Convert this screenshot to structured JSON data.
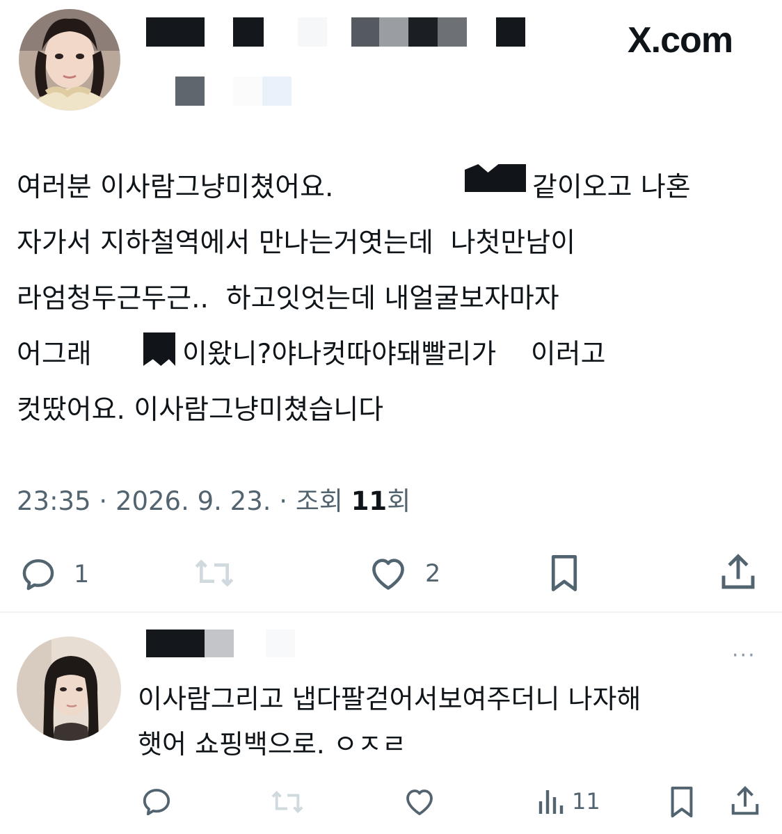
{
  "header": {
    "logo_text": "X.com"
  },
  "tweet": {
    "lines": [
      "여러분 이사람그냥미쳤어요.  ",
      "자가서 지하철역에서 만나는거엿는데  나첫만남이",
      "라엄청두근두근..  하고잇엇는데 내얼굴보자마자",
      "어그래",
      "컷땄어요. 이사람그냥미쳤습니다"
    ],
    "line1_tail": "같이오고 나혼",
    "line4_tail": "이왔니?야나컷따야돼빨리가    이러고",
    "meta_time": "23:35",
    "meta_date": "2026. 9. 23.",
    "meta_views_label": "조회",
    "meta_views_count": "11",
    "meta_views_suffix": "회",
    "meta_sep": "·"
  },
  "actions": {
    "reply_count": "1",
    "like_count": "2"
  },
  "reply": {
    "lines": [
      "이사람그리고 냅다팔걷어서보여주더니 나자해",
      "햇어 쇼핑백으로. ㅇㅈㄹ"
    ],
    "more_label": "···",
    "views_count": "11"
  },
  "colors": {
    "text": "#0f1419",
    "secondary": "#536471",
    "icon": "#536471",
    "divider": "#eff3f4"
  }
}
